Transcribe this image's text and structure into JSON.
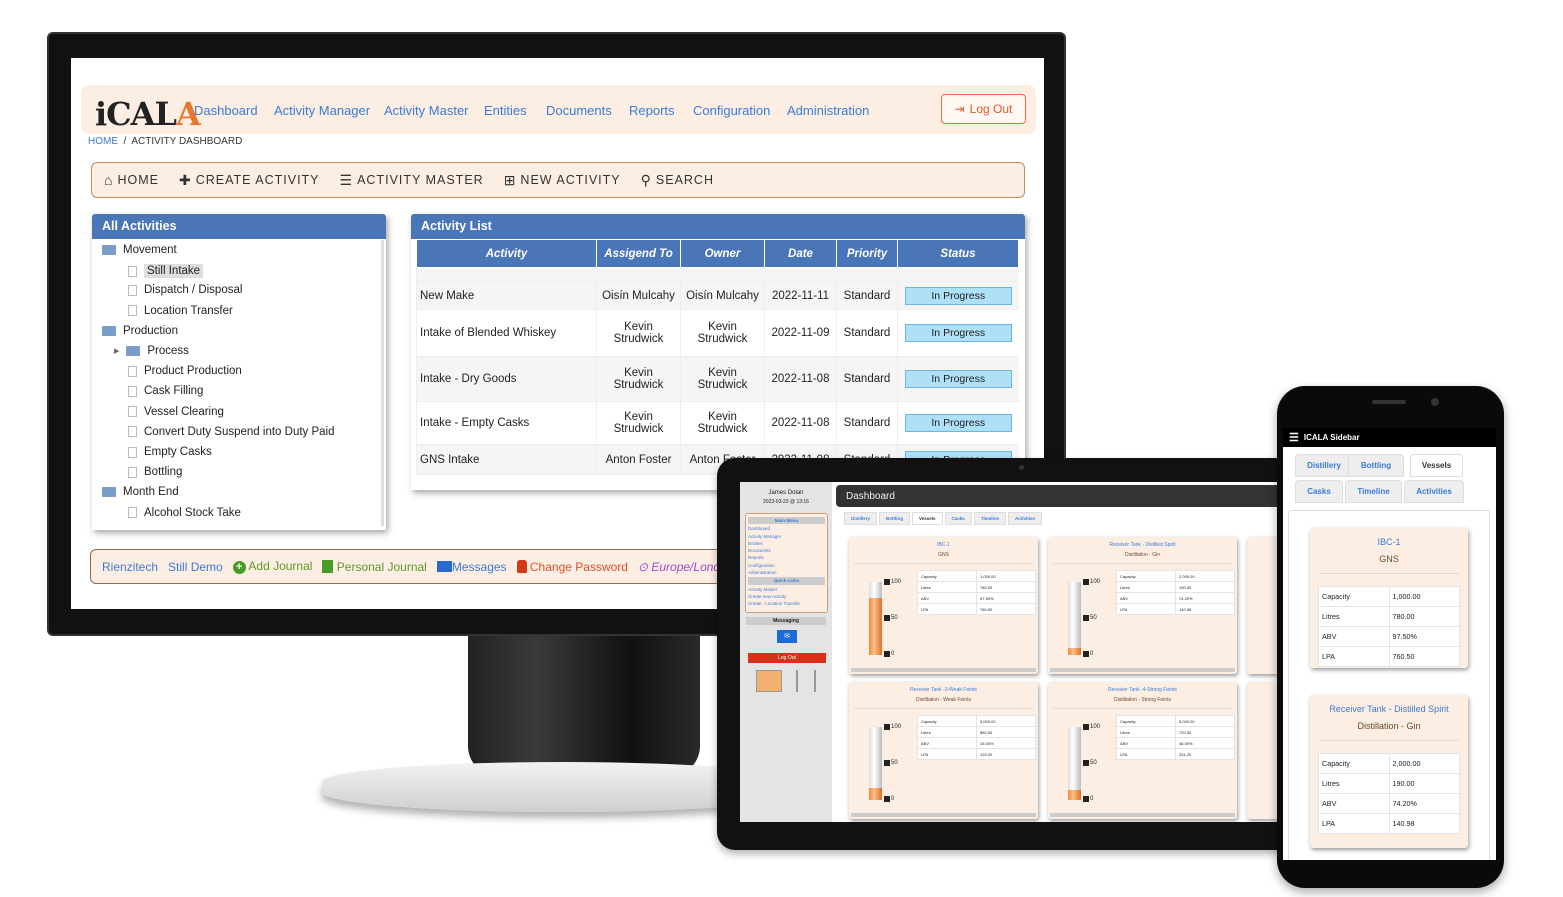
{
  "desktop": {
    "logo": "iCALA",
    "nav": [
      "Dashboard",
      "Activity Manager",
      "Activity Master",
      "Entities",
      "Documents",
      "Reports",
      "Configuration",
      "Administration"
    ],
    "logout": "Log Out",
    "breadcrumb": {
      "home": "HOME",
      "current": "ACTIVITY DASHBOARD"
    },
    "toolbar": [
      "HOME",
      "CREATE ACTIVITY",
      "ACTIVITY MASTER",
      "NEW ACTIVITY",
      "SEARCH"
    ],
    "all_activities": {
      "title": "All Activities",
      "tree": [
        {
          "label": "Movement",
          "type": "folder",
          "level": 0
        },
        {
          "label": "Still Intake",
          "type": "file",
          "level": 1,
          "selected": true
        },
        {
          "label": "Dispatch / Disposal",
          "type": "file",
          "level": 1
        },
        {
          "label": "Location Transfer",
          "type": "file",
          "level": 1
        },
        {
          "label": "Production",
          "type": "folder",
          "level": 0
        },
        {
          "label": "Process",
          "type": "folder",
          "level": 1,
          "collapsed": true
        },
        {
          "label": "Product Production",
          "type": "file",
          "level": 1
        },
        {
          "label": "Cask Filling",
          "type": "file",
          "level": 1
        },
        {
          "label": "Vessel Clearing",
          "type": "file",
          "level": 1
        },
        {
          "label": "Convert Duty Suspend into Duty Paid",
          "type": "file",
          "level": 1
        },
        {
          "label": "Empty Casks",
          "type": "file",
          "level": 1
        },
        {
          "label": "Bottling",
          "type": "file",
          "level": 1
        },
        {
          "label": "Month End",
          "type": "folder",
          "level": 0
        },
        {
          "label": "Alcohol Stock Take",
          "type": "file",
          "level": 1
        }
      ]
    },
    "activity_list": {
      "title": "Activity List",
      "columns": [
        "Activity",
        "Assigend To",
        "Owner",
        "Date",
        "Priority",
        "Status"
      ],
      "rows": [
        [
          "New Make",
          "Oisín Mulcahy",
          "Oisín Mulcahy",
          "2022-11-11",
          "Standard",
          "In Progress"
        ],
        [
          "Intake of Blended Whiskey",
          "Kevin Strudwick",
          "Kevin Strudwick",
          "2022-11-09",
          "Standard",
          "In Progress"
        ],
        [
          "Intake - Dry Goods",
          "Kevin Strudwick",
          "Kevin Strudwick",
          "2022-11-08",
          "Standard",
          "In Progress"
        ],
        [
          "Intake - Empty Casks",
          "Kevin Strudwick",
          "Kevin Strudwick",
          "2022-11-08",
          "Standard",
          "In Progress"
        ],
        [
          "GNS Intake",
          "Anton Foster",
          "Anton Foster",
          "2022-11-08",
          "Standard",
          "In Progress"
        ]
      ]
    },
    "footer": {
      "company": "Rienzitech",
      "site": "Still Demo",
      "add_journal": "Add Journal",
      "personal_journal": "Personal Journal",
      "messages": "Messages",
      "change_password": "Change Password",
      "timezone": "Europe/London"
    }
  },
  "tablet": {
    "user": "James Dolan",
    "datetime": "2023-03-23 @ 13:16",
    "main_menu_title": "Main Menu",
    "main_menu": [
      "Dashboard",
      "Activity Manager",
      "Entities",
      "Documents",
      "Reports",
      "Configuration",
      "Administration"
    ],
    "quick_links_title": "Quick Links",
    "quick_links": [
      "Activity Master",
      "Create new Activity",
      "Create : Location Transfer"
    ],
    "messaging_title": "Messaging",
    "logout": "Log Out",
    "header": "Dashboard",
    "tabs": [
      "Distillery",
      "Bottling",
      "Vessels",
      "Casks",
      "Timeline",
      "Activities"
    ],
    "active_tab": "Vessels"
  },
  "vessels": [
    {
      "name": "IBC-1",
      "sub": "GNS",
      "capacity": "1,000.00",
      "litres": "780.00",
      "abv": "97.50%",
      "lpa": "760.50",
      "fill_pct": 78
    },
    {
      "name": "Receiver Tank - Distilled Spirit",
      "sub": "Distillation - Gin",
      "capacity": "2,000.00",
      "litres": "190.00",
      "abv": "74.20%",
      "lpa": "140.98",
      "fill_pct": 10
    },
    {
      "name": "Receiver Tank -3-Weak Feints",
      "sub": "Distillation - Weak Feints",
      "capacity": "5,000.00",
      "litres": "860.00",
      "abv": "15.00%",
      "lpa": "129.00",
      "fill_pct": 17
    },
    {
      "name": "Receiver Tank -4-Strong Feints",
      "sub": "Distillation - Strong Feints",
      "capacity": "5,000.00",
      "litres": "720.00",
      "abv": "46.00%",
      "lpa": "331.20",
      "fill_pct": 14
    }
  ],
  "vessel_labels": {
    "capacity": "Capacity",
    "litres": "Litres",
    "abv": "ABV",
    "lpa": "LPA"
  },
  "gauge_ticks": [
    "100",
    "50",
    "0"
  ],
  "phone": {
    "title": "ICALA Sidebar",
    "tabs": [
      "Distillery",
      "Bottling",
      "Vessels",
      "Casks",
      "Timeline",
      "Activities"
    ],
    "active_tab": "Vessels"
  },
  "colors": {
    "accent": "#3a7bd5",
    "header_blue": "#4a76b8",
    "peach": "#fdeee4",
    "status": "#aee0f7",
    "logout_red": "#d9301a"
  }
}
